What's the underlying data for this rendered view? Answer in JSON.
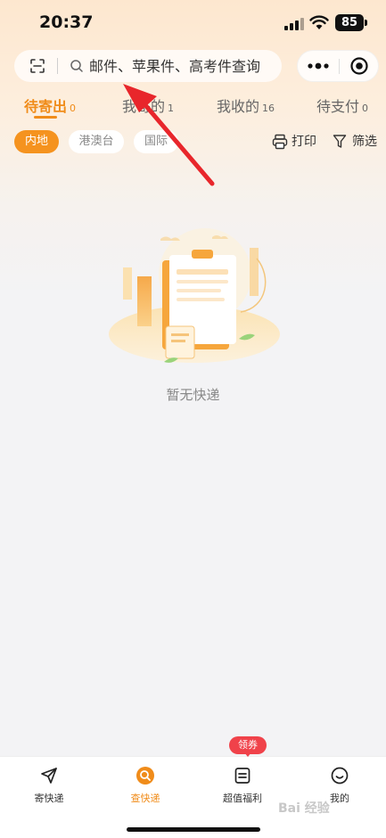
{
  "status_bar": {
    "time": "20:37",
    "battery": "85"
  },
  "search": {
    "placeholder": "邮件、苹果件、高考件查询"
  },
  "tabs": [
    {
      "label": "待寄出",
      "count": "0"
    },
    {
      "label": "我寄的",
      "count": "1"
    },
    {
      "label": "我收的",
      "count": "16"
    },
    {
      "label": "待支付",
      "count": "0"
    }
  ],
  "filters": {
    "chips": [
      "内地",
      "港澳台",
      "国际"
    ],
    "print_label": "打印",
    "filter_label": "筛选"
  },
  "empty": {
    "message": "暂无快递"
  },
  "tabbar": {
    "items": [
      {
        "label": "寄快递",
        "icon": "send-plane-icon"
      },
      {
        "label": "查快递",
        "icon": "search-parcel-icon"
      },
      {
        "label": "超值福利",
        "icon": "coupon-icon"
      },
      {
        "label": "我的",
        "icon": "smile-icon"
      }
    ],
    "badge": "领券"
  },
  "colors": {
    "accent": "#f08c1a",
    "badge": "#f0424a"
  },
  "watermark": "Bai 经验"
}
